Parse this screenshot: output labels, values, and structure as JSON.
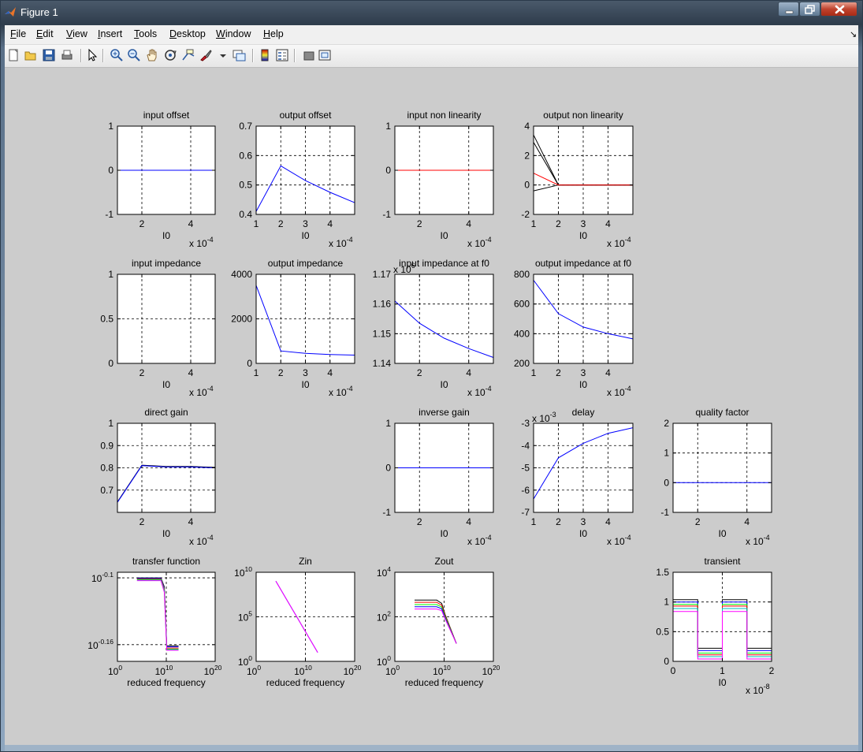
{
  "window": {
    "title": "Figure 1",
    "controls": {
      "minimize": "minimize-icon",
      "maximize": "maximize-icon",
      "close": "close-icon"
    }
  },
  "menubar": {
    "items": [
      {
        "label": "File",
        "mnemonic": "F"
      },
      {
        "label": "Edit",
        "mnemonic": "E"
      },
      {
        "label": "View",
        "mnemonic": "V"
      },
      {
        "label": "Insert",
        "mnemonic": "I"
      },
      {
        "label": "Tools",
        "mnemonic": "T"
      },
      {
        "label": "Desktop",
        "mnemonic": "D"
      },
      {
        "label": "Window",
        "mnemonic": "W"
      },
      {
        "label": "Help",
        "mnemonic": "H"
      }
    ],
    "dock_icon": "dock-arrow-icon"
  },
  "toolbar": {
    "buttons": [
      "new-figure-icon",
      "open-file-icon",
      "save-icon",
      "print-icon",
      "edit-plot-icon",
      "zoom-in-icon",
      "zoom-out-icon",
      "pan-icon",
      "rotate-3d-icon",
      "data-cursor-icon",
      "brush-icon",
      "brush-menu-icon",
      "link-plot-icon",
      "colorbar-icon",
      "legend-icon",
      "hide-plot-tools-icon",
      "show-plot-tools-icon"
    ]
  },
  "colors": {
    "figure_background": "#cccccc",
    "axes_background": "#ffffff",
    "blue": "#0000ff",
    "red": "#ff0000",
    "green": "#00ff00",
    "cyan": "#00bfbf",
    "magenta": "#ff00ff",
    "black": "#000000"
  },
  "chart_data": [
    {
      "id": "input-offset",
      "type": "line",
      "title": "input offset",
      "xlabel": "I0",
      "x_exponent": "x 10",
      "x_exponent_power": "-4",
      "xlim": [
        1,
        5
      ],
      "ylim": [
        -1,
        1
      ],
      "xticks": [
        "2",
        "4"
      ],
      "yticks": [
        "-1",
        "0",
        "1"
      ],
      "series": [
        {
          "color": "#0000ff",
          "x": [
            1,
            5
          ],
          "y": [
            0,
            0
          ]
        }
      ]
    },
    {
      "id": "output-offset",
      "type": "line",
      "title": "output offset",
      "xlabel": "I0",
      "x_exponent": "x 10",
      "x_exponent_power": "-4",
      "xlim": [
        1,
        5
      ],
      "ylim": [
        0.4,
        0.7
      ],
      "xticks": [
        "1",
        "2",
        "3",
        "4"
      ],
      "yticks": [
        "0.4",
        "0.5",
        "0.6",
        "0.7"
      ],
      "series": [
        {
          "color": "#0000ff",
          "x": [
            1,
            2,
            3,
            4,
            5
          ],
          "y": [
            0.41,
            0.565,
            0.515,
            0.475,
            0.44
          ]
        }
      ]
    },
    {
      "id": "input-non-linearity",
      "type": "line",
      "title": "input non linearity",
      "xlabel": "I0",
      "x_exponent": "x 10",
      "x_exponent_power": "-4",
      "xlim": [
        1,
        5
      ],
      "ylim": [
        -1,
        1
      ],
      "xticks": [
        "2",
        "4"
      ],
      "yticks": [
        "-1",
        "0",
        "1"
      ],
      "series": [
        {
          "color": "#ff0000",
          "x": [
            1,
            5
          ],
          "y": [
            0,
            0
          ]
        }
      ]
    },
    {
      "id": "output-non-linearity",
      "type": "line",
      "title": "output non linearity",
      "xlabel": "I0",
      "x_exponent": "x 10",
      "x_exponent_power": "-4",
      "xlim": [
        1,
        5
      ],
      "ylim": [
        -2,
        4
      ],
      "xticks": [
        "1",
        "2",
        "3",
        "4"
      ],
      "yticks": [
        "-2",
        "0",
        "2",
        "4"
      ],
      "series": [
        {
          "color": "#000000",
          "x": [
            1,
            2,
            5
          ],
          "y": [
            3.4,
            0,
            0
          ]
        },
        {
          "color": "#000000",
          "x": [
            1,
            2,
            5
          ],
          "y": [
            2.9,
            0,
            0
          ]
        },
        {
          "color": "#000000",
          "x": [
            1,
            2,
            5
          ],
          "y": [
            -0.4,
            0,
            0
          ]
        },
        {
          "color": "#ff0000",
          "x": [
            1,
            2,
            5
          ],
          "y": [
            0.8,
            0,
            0
          ]
        }
      ]
    },
    {
      "id": "input-impedance",
      "type": "line",
      "title": "input impedance",
      "xlabel": "I0",
      "x_exponent": "x 10",
      "x_exponent_power": "-4",
      "xlim": [
        1,
        5
      ],
      "ylim": [
        0,
        1
      ],
      "xticks": [
        "2",
        "4"
      ],
      "yticks": [
        "0",
        "0.5",
        "1"
      ],
      "series": []
    },
    {
      "id": "output-impedance",
      "type": "line",
      "title": "output impedance",
      "xlabel": "I0",
      "x_exponent": "x 10",
      "x_exponent_power": "-4",
      "xlim": [
        1,
        5
      ],
      "ylim": [
        0,
        4000
      ],
      "xticks": [
        "1",
        "2",
        "3",
        "4"
      ],
      "yticks": [
        "0",
        "2000",
        "4000"
      ],
      "series": [
        {
          "color": "#0000ff",
          "x": [
            1,
            2,
            3,
            4,
            5
          ],
          "y": [
            3500,
            560,
            450,
            400,
            370
          ]
        }
      ]
    },
    {
      "id": "input-impedance-at-f0",
      "type": "line",
      "title": "input impedance at f0",
      "xlabel": "I0",
      "x_exponent": "x 10",
      "x_exponent_power": "-4",
      "y_exponent": "x 10",
      "y_exponent_power": "6",
      "xlim": [
        1,
        5
      ],
      "ylim": [
        1.14,
        1.17
      ],
      "xticks": [
        "2",
        "4"
      ],
      "yticks": [
        "1.14",
        "1.15",
        "1.16",
        "1.17"
      ],
      "series": [
        {
          "color": "#0000ff",
          "x": [
            1,
            2,
            3,
            4,
            5
          ],
          "y": [
            1.161,
            1.1535,
            1.1485,
            1.145,
            1.142
          ]
        }
      ]
    },
    {
      "id": "output-impedance-at-f0",
      "type": "line",
      "title": "output impedance at f0",
      "xlabel": "I0",
      "x_exponent": "x 10",
      "x_exponent_power": "-4",
      "xlim": [
        1,
        5
      ],
      "ylim": [
        200,
        800
      ],
      "xticks": [
        "1",
        "2",
        "3",
        "4"
      ],
      "yticks": [
        "200",
        "400",
        "600",
        "800"
      ],
      "series": [
        {
          "color": "#0000ff",
          "x": [
            1,
            2,
            3,
            4,
            5
          ],
          "y": [
            760,
            535,
            445,
            400,
            365
          ]
        }
      ]
    },
    {
      "id": "direct-gain",
      "type": "line",
      "title": "direct gain",
      "xlabel": "I0",
      "x_exponent": "x 10",
      "x_exponent_power": "-4",
      "xlim": [
        1,
        5
      ],
      "ylim": [
        0.6,
        1
      ],
      "xticks": [
        "2",
        "4"
      ],
      "yticks": [
        "0.7",
        "0.8",
        "0.9",
        "1"
      ],
      "series": [
        {
          "color": "#000000",
          "x": [
            1,
            2,
            3,
            4,
            5
          ],
          "y": [
            0.647,
            0.812,
            0.806,
            0.806,
            0.802
          ]
        },
        {
          "color": "#0000ff",
          "x": [
            1,
            2,
            3,
            4,
            5
          ],
          "y": [
            0.645,
            0.81,
            0.804,
            0.804,
            0.8
          ]
        }
      ]
    },
    {
      "id": "inverse-gain",
      "type": "line",
      "title": "inverse gain",
      "xlabel": "I0",
      "x_exponent": "x 10",
      "x_exponent_power": "-4",
      "xlim": [
        1,
        5
      ],
      "ylim": [
        -1,
        1
      ],
      "xticks": [
        "2",
        "4"
      ],
      "yticks": [
        "-1",
        "0",
        "1"
      ],
      "series": [
        {
          "color": "#0000ff",
          "x": [
            1,
            5
          ],
          "y": [
            0,
            0
          ]
        }
      ]
    },
    {
      "id": "delay",
      "type": "line",
      "title": "delay",
      "xlabel": "I0",
      "x_exponent": "x 10",
      "x_exponent_power": "-4",
      "y_exponent": "x 10",
      "y_exponent_power": "-3",
      "xlim": [
        1,
        5
      ],
      "ylim": [
        -7,
        -3
      ],
      "xticks": [
        "1",
        "2",
        "3",
        "4"
      ],
      "yticks": [
        "-7",
        "-6",
        "-5",
        "-4",
        "-3"
      ],
      "series": [
        {
          "color": "#0000ff",
          "x": [
            1,
            2,
            3,
            4,
            5
          ],
          "y": [
            -6.4,
            -4.55,
            -3.9,
            -3.45,
            -3.2
          ]
        }
      ]
    },
    {
      "id": "quality-factor",
      "type": "line",
      "title": "quality factor",
      "xlabel": "I0",
      "x_exponent": "x 10",
      "x_exponent_power": "-4",
      "xlim": [
        1,
        5
      ],
      "ylim": [
        -1,
        2
      ],
      "xticks": [
        "2",
        "4"
      ],
      "yticks": [
        "-1",
        "0",
        "1",
        "2"
      ],
      "series": [
        {
          "color": "#0000ff",
          "x": [
            1,
            5
          ],
          "y": [
            0,
            0
          ]
        }
      ]
    },
    {
      "id": "transfer-function",
      "type": "line",
      "title": "transfer function",
      "xlabel": "reduced frequency",
      "xscale": "log",
      "yscale": "log",
      "xlim": [
        0,
        20
      ],
      "ylim": [
        -0.175,
        -0.095
      ],
      "xticks": [
        {
          "base": "10",
          "exp": "0"
        },
        {
          "base": "10",
          "exp": "10"
        },
        {
          "base": "10",
          "exp": "20"
        }
      ],
      "yticks": [
        {
          "base": "10",
          "exp": "-0.16",
          "value": -0.16
        },
        {
          "base": "10",
          "exp": "-0.1",
          "value": -0.1
        }
      ],
      "series": [
        {
          "color": "#000000",
          "x": [
            4,
            8.9,
            9.6,
            10.1,
            12.5
          ],
          "y": [
            -0.1,
            -0.1,
            -0.108,
            -0.161,
            -0.161
          ]
        },
        {
          "color": "#0000ff",
          "x": [
            4,
            8.9,
            9.6,
            10.1,
            12.5
          ],
          "y": [
            -0.1005,
            -0.1005,
            -0.109,
            -0.162,
            -0.162
          ]
        },
        {
          "color": "#ff0000",
          "x": [
            4,
            8.9,
            9.6,
            10.1,
            12.5
          ],
          "y": [
            -0.101,
            -0.101,
            -0.11,
            -0.163,
            -0.163
          ]
        },
        {
          "color": "#00ff00",
          "x": [
            4,
            8.9,
            9.6,
            10.1,
            12.5
          ],
          "y": [
            -0.1015,
            -0.1015,
            -0.111,
            -0.164,
            -0.164
          ]
        },
        {
          "color": "#00bfbf",
          "x": [
            4,
            8.9,
            9.6,
            10.1,
            12.5
          ],
          "y": [
            -0.102,
            -0.102,
            -0.112,
            -0.1645,
            -0.1645
          ]
        },
        {
          "color": "#ff00ff",
          "x": [
            4,
            8.9,
            9.6,
            10.1,
            12.5
          ],
          "y": [
            -0.1025,
            -0.1025,
            -0.113,
            -0.165,
            -0.165
          ]
        }
      ]
    },
    {
      "id": "zin",
      "type": "line",
      "title": "Zin",
      "xlabel": "reduced frequency",
      "xscale": "log",
      "yscale": "log",
      "xlim": [
        0,
        20
      ],
      "ylim": [
        0,
        10
      ],
      "xticks": [
        {
          "base": "10",
          "exp": "0"
        },
        {
          "base": "10",
          "exp": "10"
        },
        {
          "base": "10",
          "exp": "20"
        }
      ],
      "yticks": [
        {
          "base": "10",
          "exp": "0",
          "value": 0
        },
        {
          "base": "10",
          "exp": "5",
          "value": 5
        },
        {
          "base": "10",
          "exp": "10",
          "value": 10
        }
      ],
      "series": [
        {
          "color": "#0000ff",
          "x": [
            4,
            12.5
          ],
          "y": [
            9,
            1
          ]
        },
        {
          "color": "#ff00ff",
          "x": [
            4,
            12.5
          ],
          "y": [
            9,
            1
          ]
        }
      ]
    },
    {
      "id": "zout",
      "type": "line",
      "title": "Zout",
      "xlabel": "reduced frequency",
      "xscale": "log",
      "yscale": "log",
      "xlim": [
        0,
        20
      ],
      "ylim": [
        0,
        4
      ],
      "xticks": [
        {
          "base": "10",
          "exp": "0"
        },
        {
          "base": "10",
          "exp": "10"
        },
        {
          "base": "10",
          "exp": "20"
        }
      ],
      "yticks": [
        {
          "base": "10",
          "exp": "0",
          "value": 0
        },
        {
          "base": "10",
          "exp": "2",
          "value": 2
        },
        {
          "base": "10",
          "exp": "4",
          "value": 4
        }
      ],
      "series": [
        {
          "color": "#000000",
          "x": [
            4,
            8.5,
            9.5,
            10.2,
            12.5
          ],
          "y": [
            2.75,
            2.75,
            2.6,
            2.1,
            0.8
          ]
        },
        {
          "color": "#ff0000",
          "x": [
            4,
            8.5,
            9.5,
            10.2,
            12.5
          ],
          "y": [
            2.65,
            2.65,
            2.52,
            2.05,
            0.8
          ]
        },
        {
          "color": "#00ff00",
          "x": [
            4,
            8.5,
            9.5,
            10.2,
            12.5
          ],
          "y": [
            2.55,
            2.55,
            2.44,
            2.0,
            0.8
          ]
        },
        {
          "color": "#0000ff",
          "x": [
            4,
            8.5,
            9.5,
            10.2,
            12.5
          ],
          "y": [
            2.45,
            2.45,
            2.36,
            1.95,
            0.8
          ]
        },
        {
          "color": "#ff00ff",
          "x": [
            4,
            8.5,
            9.5,
            10.2,
            12.5
          ],
          "y": [
            2.35,
            2.35,
            2.28,
            1.9,
            0.8
          ]
        }
      ]
    },
    {
      "id": "transient",
      "type": "line",
      "title": "transient",
      "xlabel": "I0",
      "x_exponent": "x 10",
      "x_exponent_power": "-8",
      "xlim": [
        0,
        2
      ],
      "ylim": [
        0,
        1.5
      ],
      "xticks": [
        "0",
        "1",
        "2"
      ],
      "yticks": [
        "0",
        "0.5",
        "1",
        "1.5"
      ],
      "series": [
        {
          "color": "#000000",
          "x": [
            0,
            0,
            0.5,
            0.5,
            1,
            1,
            1.5,
            1.5,
            2
          ],
          "y": [
            0,
            1.04,
            1.04,
            0.22,
            0.22,
            1.04,
            1.04,
            0.22,
            0.22
          ]
        },
        {
          "color": "#0000ff",
          "x": [
            0,
            0,
            0.5,
            0.5,
            1,
            1,
            1.5,
            1.5,
            2
          ],
          "y": [
            0,
            1.0,
            1.0,
            0.18,
            0.18,
            1.0,
            1.0,
            0.18,
            0.18
          ]
        },
        {
          "color": "#00ff00",
          "x": [
            0,
            0,
            0.5,
            0.5,
            1,
            1,
            1.5,
            1.5,
            2
          ],
          "y": [
            0,
            0.96,
            0.96,
            0.14,
            0.14,
            0.96,
            0.96,
            0.14,
            0.14
          ]
        },
        {
          "color": "#ff0000",
          "x": [
            0,
            0,
            0.5,
            0.5,
            1,
            1,
            1.5,
            1.5,
            2
          ],
          "y": [
            0,
            0.93,
            0.93,
            0.11,
            0.11,
            0.93,
            0.93,
            0.11,
            0.11
          ]
        },
        {
          "color": "#00bfbf",
          "x": [
            0,
            0,
            0.5,
            0.5,
            1,
            1,
            1.5,
            1.5,
            2
          ],
          "y": [
            0,
            0.89,
            0.89,
            0.08,
            0.08,
            0.89,
            0.89,
            0.08,
            0.08
          ]
        },
        {
          "color": "#ff00ff",
          "x": [
            0,
            0,
            0.5,
            0.5,
            1,
            1,
            1.5,
            1.5,
            2
          ],
          "y": [
            0,
            0.84,
            0.84,
            0.04,
            0.04,
            0.84,
            0.84,
            0.04,
            0.04
          ]
        }
      ]
    }
  ]
}
